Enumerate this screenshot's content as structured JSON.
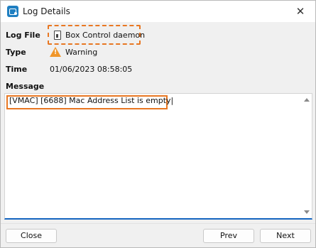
{
  "window": {
    "title": "Log Details"
  },
  "fields": {
    "log_file_label": "Log File",
    "log_file_value": "Box Control daemon",
    "type_label": "Type",
    "type_value": "Warning",
    "time_label": "Time",
    "time_value": "01/06/2023 08:58:05",
    "message_label": "Message"
  },
  "message": {
    "text": "[VMAC] [6688] Mac Address List is empty|"
  },
  "buttons": {
    "close": "Close",
    "prev": "Prev",
    "next": "Next"
  },
  "icons": {
    "app": "log-details-app-icon",
    "log_file": "box-control-device-icon",
    "type": "warning-triangle-icon"
  },
  "colors": {
    "highlight": "#e87722",
    "accent": "#1565c0",
    "warning": "#f0962a"
  }
}
